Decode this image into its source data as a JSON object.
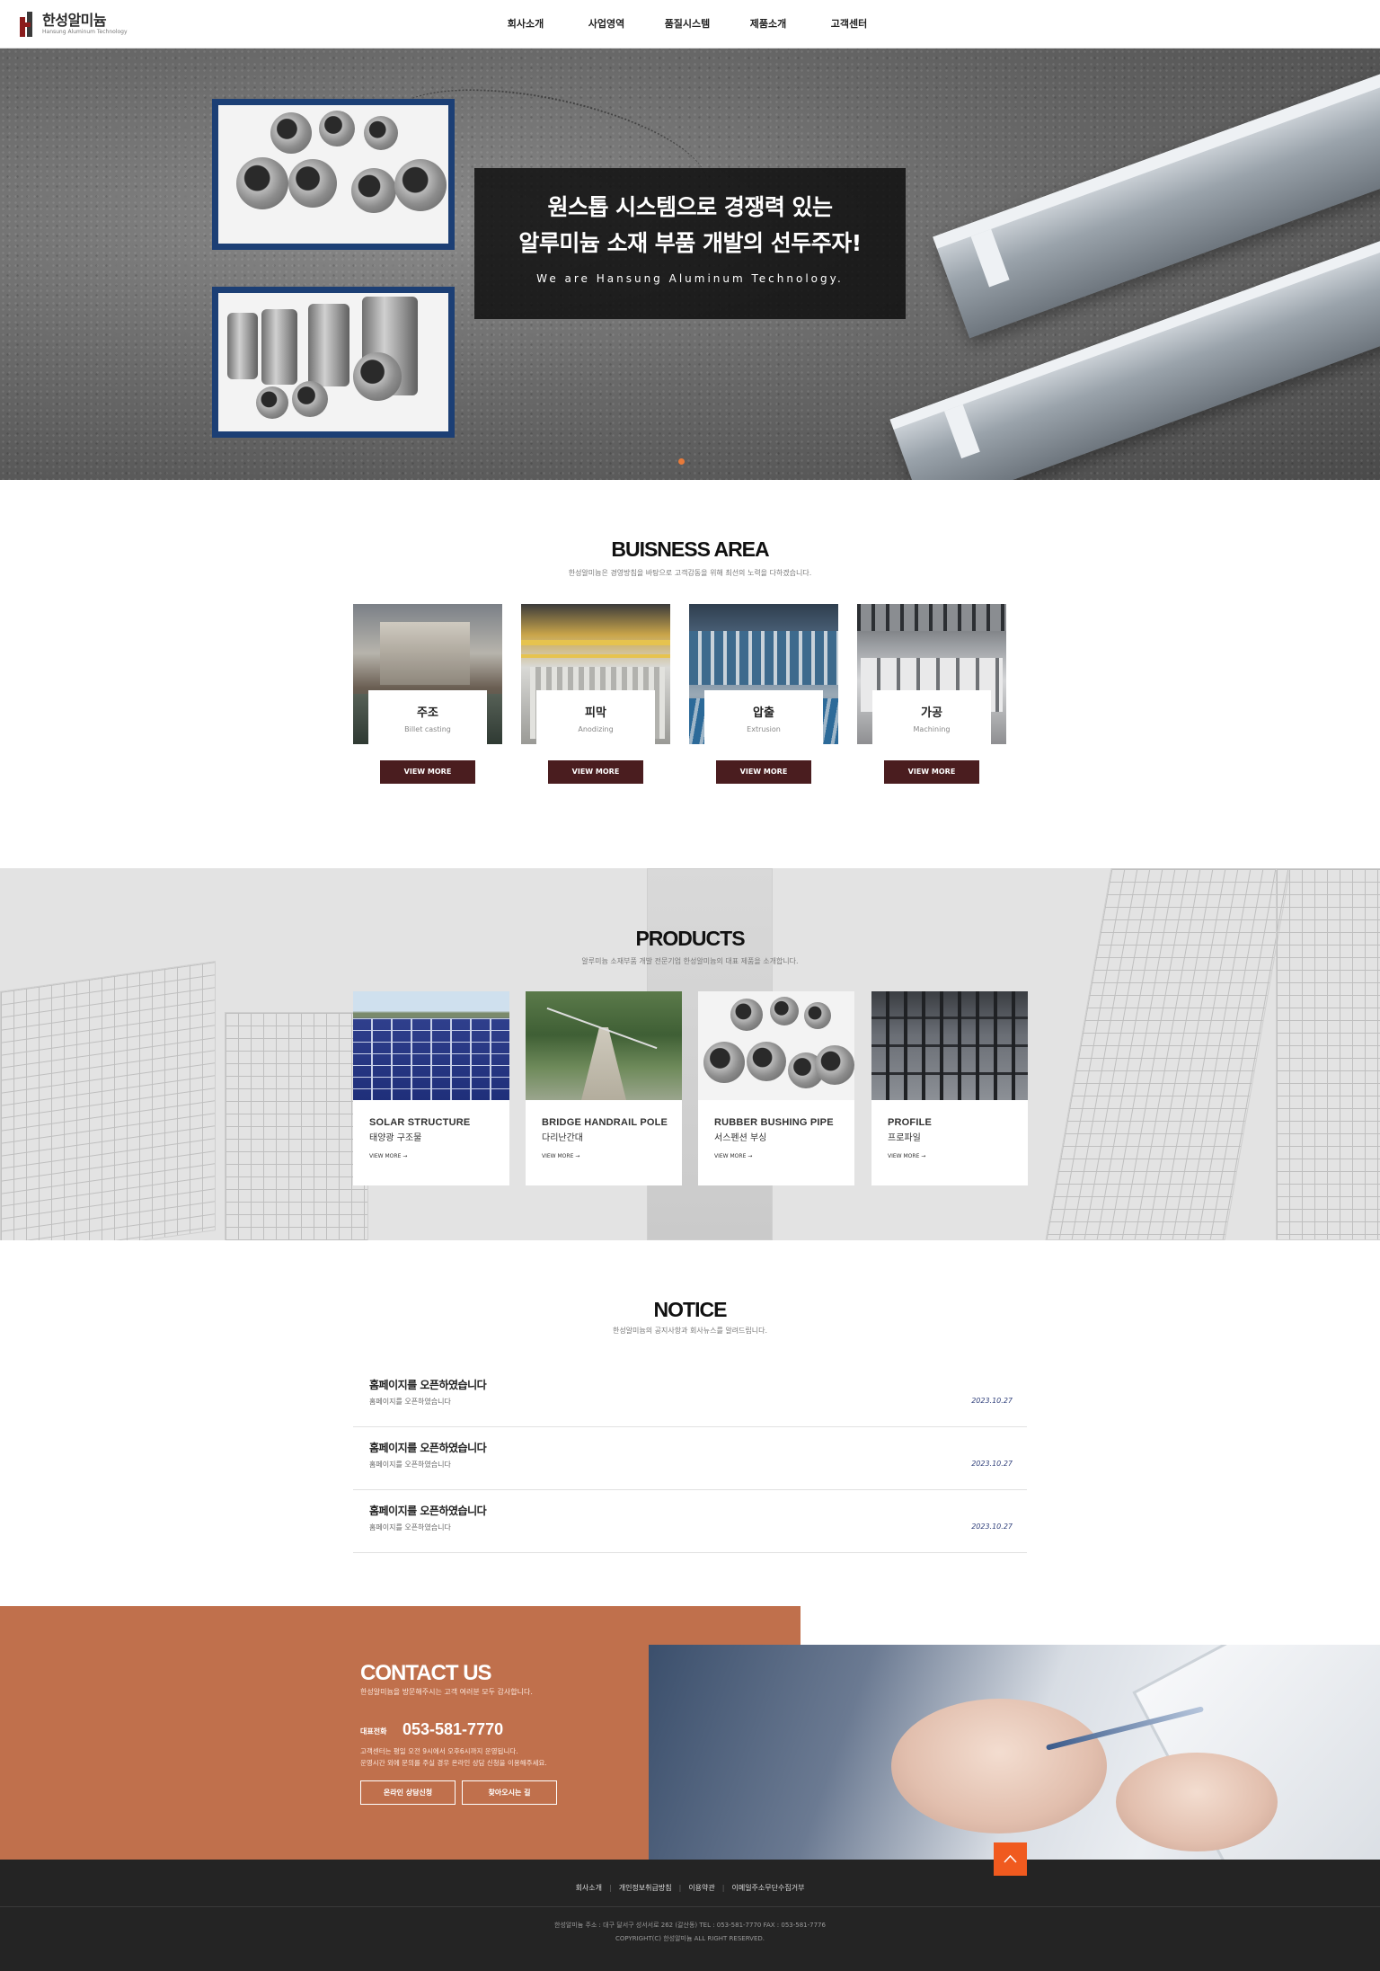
{
  "header": {
    "logo_kr": "한성알미늄",
    "logo_en": "Hansung Aluminum Technology",
    "nav": [
      "회사소개",
      "사업영역",
      "품질시스템",
      "제품소개",
      "고객센터"
    ]
  },
  "hero": {
    "line1": "원스톱 시스템으로 경쟁력 있는",
    "line2": "알루미늄 소재 부품 개발의 선두주자!",
    "sub": "We are Hansung Aluminum Technology."
  },
  "business": {
    "title": "BUISNESS AREA",
    "subtitle": "한성알미늄은 경영방침을 바탕으로 고객감동을 위해 최선의 노력을 다하겠습니다.",
    "cards": [
      {
        "kr": "주조",
        "en": "Billet casting",
        "button": "VIEW MORE"
      },
      {
        "kr": "피막",
        "en": "Anodizing",
        "button": "VIEW MORE"
      },
      {
        "kr": "압출",
        "en": "Extrusion",
        "button": "VIEW MORE"
      },
      {
        "kr": "가공",
        "en": "Machining",
        "button": "VIEW MORE"
      }
    ]
  },
  "products": {
    "title": "PRODUCTS",
    "subtitle": "알루미늄 소재부품 개발 전문기업 한성알미늄의 대표 제품을 소개합니다.",
    "cards": [
      {
        "en": "SOLAR STRUCTURE",
        "kr": "태양광 구조물",
        "more": "VIEW MORE →"
      },
      {
        "en": "BRIDGE HANDRAIL POLE",
        "kr": "다리난간대",
        "more": "VIEW MORE →"
      },
      {
        "en": "RUBBER BUSHING PIPE",
        "kr": "서스펜션 부싱",
        "more": "VIEW MORE →"
      },
      {
        "en": "PROFILE",
        "kr": "프로파일",
        "more": "VIEW MORE →"
      }
    ]
  },
  "notice": {
    "title": "NOTICE",
    "subtitle": "한성알미늄의 공지사항과 회사뉴스를 알려드립니다.",
    "items": [
      {
        "title": "홈페이지를 오픈하였습니다",
        "desc": "홈페이지를 오픈하였습니다",
        "date": "2023.10.27"
      },
      {
        "title": "홈페이지를 오픈하였습니다",
        "desc": "홈페이지를 오픈하였습니다",
        "date": "2023.10.27"
      },
      {
        "title": "홈페이지를 오픈하였습니다",
        "desc": "홈페이지를 오픈하였습니다",
        "date": "2023.10.27"
      }
    ]
  },
  "contact": {
    "title": "CONTACT US",
    "subtitle": "한성알미늄을 방문해주시는 고객 여러분 모두 감사합니다.",
    "tel_label": "대표전화",
    "tel": "053-581-7770",
    "note1": "고객센터는 평일 오전 9시에서 오후6시까지 운영됩니다.",
    "note2": "운영시간 외에 문의를 주실 경우 온라인 상담 신청을 이용해주세요.",
    "btn_online": "온라인 상담신청",
    "btn_map": "찾아오시는 길"
  },
  "footer": {
    "links": [
      "회사소개",
      "개인정보취급방침",
      "이용약관",
      "이메일주소무단수집거부"
    ],
    "address": "한성알미늄    주소 : 대구 달서구 성서서로 262 (갈산동)    TEL : 053-581-7770    FAX : 053-581-7776",
    "copyright": "COPYRIGHT(C) 한성알미늄 ALL RIGHT RESERVED."
  },
  "colors": {
    "accent_orange": "#c0704c",
    "button_maroon": "#4a1d1f",
    "photo_border": "#1c3f75",
    "top_button": "#f05a1f",
    "footer_bg": "#242424"
  }
}
